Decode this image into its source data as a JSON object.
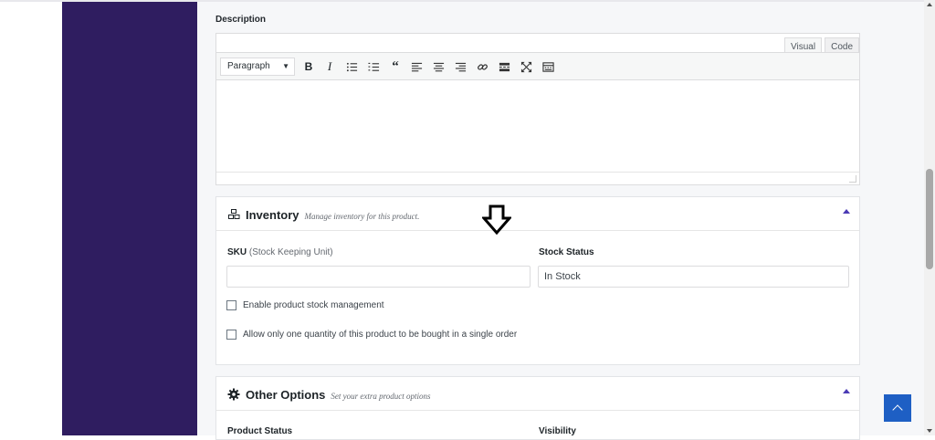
{
  "description": {
    "label": "Description",
    "tabs": [
      "Visual",
      "Code"
    ],
    "format_value": "Paragraph",
    "toolbar_icons": [
      "bold-icon",
      "italic-icon",
      "bullet-list-icon",
      "numbered-list-icon",
      "blockquote-icon",
      "align-left-icon",
      "align-center-icon",
      "align-right-icon",
      "link-icon",
      "read-more-icon",
      "fullscreen-icon",
      "toolbar-toggle-icon"
    ]
  },
  "inventory": {
    "title": "Inventory",
    "subtitle": "Manage inventory for this product.",
    "sku_label": "SKU",
    "sku_hint": "(Stock Keeping Unit)",
    "sku_value": "",
    "stock_status_label": "Stock Status",
    "stock_status_value": "In Stock",
    "check_manage_stock": "Enable product stock management",
    "check_single_qty": "Allow only one quantity of this product to be bought in a single order"
  },
  "other_options": {
    "title": "Other Options",
    "subtitle": "Set your extra product options",
    "product_status_label": "Product Status",
    "visibility_label": "Visibility"
  },
  "colors": {
    "sidebar": "#2f1d60",
    "accent": "#4b3bb5",
    "back_to_top": "#1e5fc4"
  }
}
